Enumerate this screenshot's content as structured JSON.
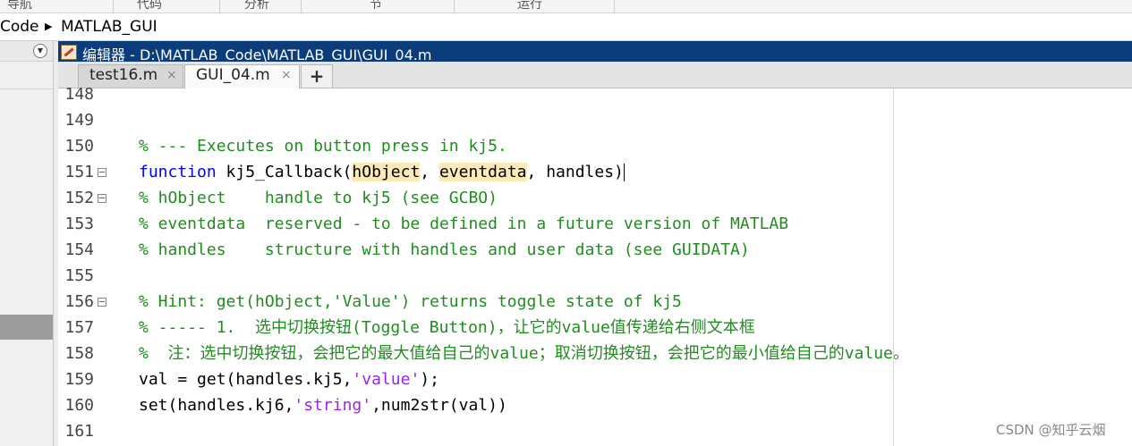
{
  "ribbon": {
    "sections": [
      "导航",
      "代码",
      "分析",
      "节",
      "运行"
    ]
  },
  "address": {
    "segments": [
      "Code",
      "MATLAB_GUI"
    ]
  },
  "editor": {
    "title": "编辑器 - D:\\MATLAB_Code\\MATLAB_GUI\\GUI_04.m",
    "tabs": [
      {
        "label": "test16.m",
        "active": false
      },
      {
        "label": "GUI_04.m",
        "active": true
      }
    ],
    "close_glyph": "×",
    "add_tab_label": "+"
  },
  "code": {
    "lines": [
      {
        "num": "148",
        "fold": false,
        "parts": []
      },
      {
        "num": "149",
        "fold": false,
        "parts": []
      },
      {
        "num": "150",
        "fold": false,
        "parts": [
          {
            "text": "% --- Executes on button press in kj5.",
            "cls": "cm"
          }
        ]
      },
      {
        "num": "151",
        "fold": true,
        "parts": [
          {
            "text": "function",
            "cls": "kw"
          },
          {
            "text": " kj5_Callback(",
            "cls": ""
          },
          {
            "text": "hObject",
            "cls": "hl"
          },
          {
            "text": ", ",
            "cls": ""
          },
          {
            "text": "eventdata",
            "cls": "hl"
          },
          {
            "text": ", handles)",
            "cls": ""
          }
        ],
        "caret": true
      },
      {
        "num": "152",
        "fold": true,
        "parts": [
          {
            "text": "% hObject    handle to kj5 (see GCBO)",
            "cls": "cm"
          }
        ]
      },
      {
        "num": "153",
        "fold": false,
        "parts": [
          {
            "text": "% eventdata  reserved - to be defined in a future version of MATLAB",
            "cls": "cm"
          }
        ]
      },
      {
        "num": "154",
        "fold": false,
        "parts": [
          {
            "text": "% handles    structure with handles and user data (see GUIDATA)",
            "cls": "cm"
          }
        ]
      },
      {
        "num": "155",
        "fold": false,
        "parts": []
      },
      {
        "num": "156",
        "fold": true,
        "parts": [
          {
            "text": "% Hint: get(hObject,'Value') returns toggle state of kj5",
            "cls": "cm"
          }
        ]
      },
      {
        "num": "157",
        "fold": false,
        "parts": [
          {
            "text": "% ----- 1.  选中切换按钮(Toggle Button)，让它的value值传递给右侧文本框",
            "cls": "cm"
          }
        ]
      },
      {
        "num": "158",
        "fold": false,
        "parts": [
          {
            "text": "%  注：选中切换按钮，会把它的最大值给自己的value；取消切换按钮，会把它的最小值给自己的value。",
            "cls": "cm"
          }
        ]
      },
      {
        "num": "159",
        "fold": false,
        "parts": [
          {
            "text": "val = get(handles.kj5,",
            "cls": ""
          },
          {
            "text": "'value'",
            "cls": "str"
          },
          {
            "text": ");",
            "cls": ""
          }
        ]
      },
      {
        "num": "160",
        "fold": false,
        "parts": [
          {
            "text": "set(handles.kj6,",
            "cls": ""
          },
          {
            "text": "'string'",
            "cls": "str"
          },
          {
            "text": ",num2str(val))",
            "cls": ""
          }
        ]
      },
      {
        "num": "161",
        "fold": false,
        "parts": []
      }
    ]
  },
  "watermark": "CSDN @知乎云烟",
  "colors": {
    "title_bar": "#0b3d7c",
    "comment": "#228b22",
    "keyword": "#0000ff",
    "string": "#a020f0",
    "highlight": "#fce9b8"
  }
}
